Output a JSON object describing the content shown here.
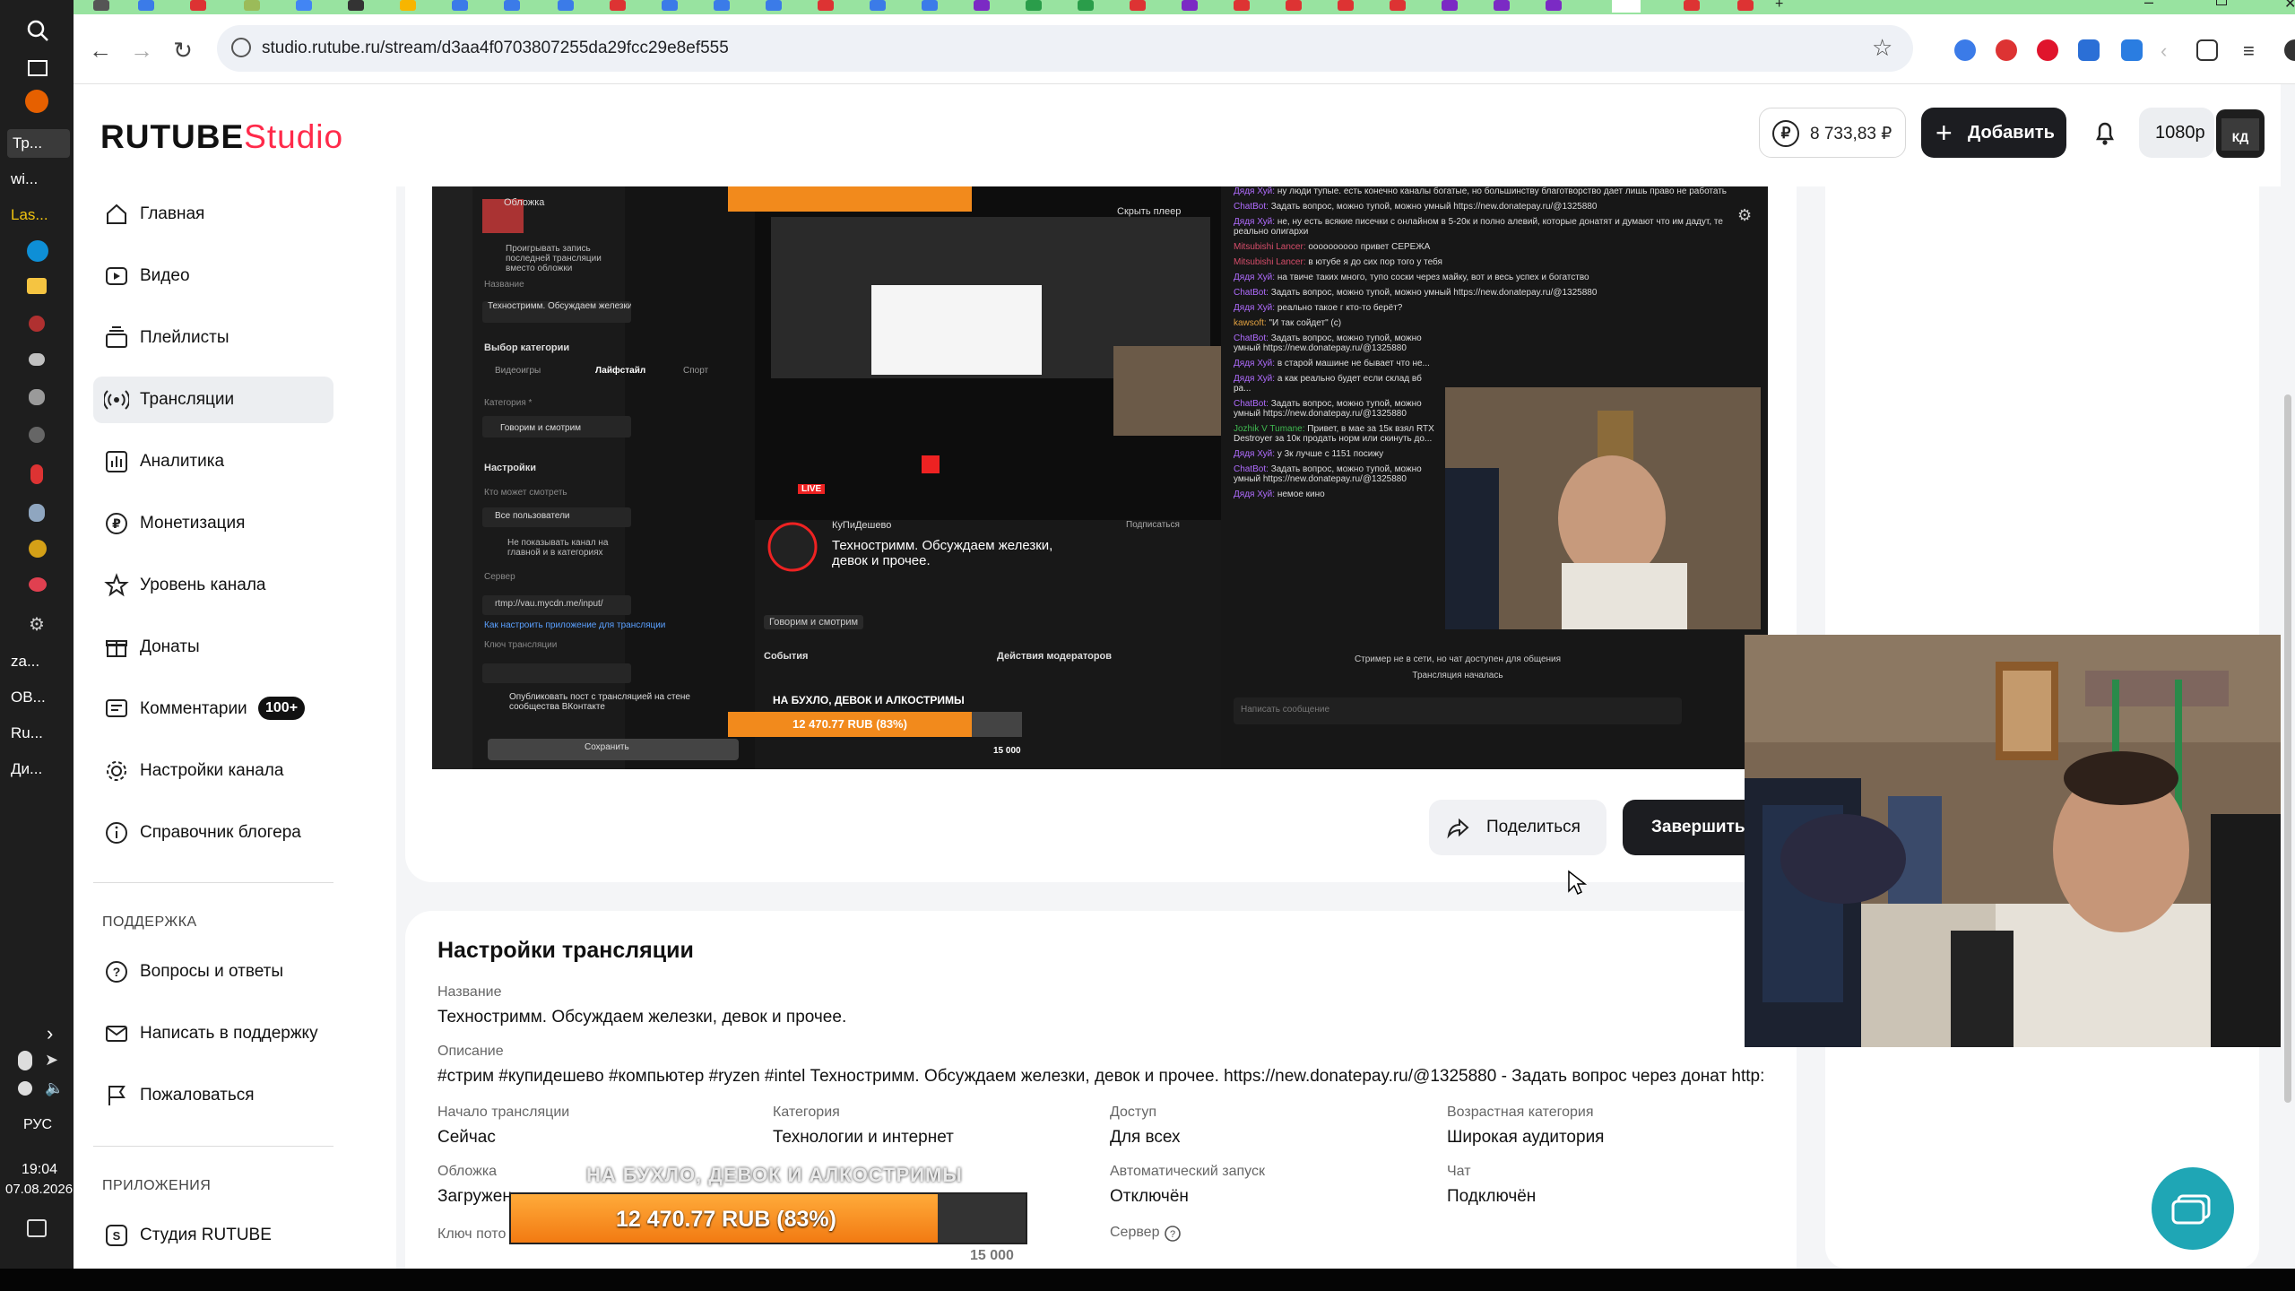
{
  "browser": {
    "url": "studio.rutube.ru/stream/d3aa4f0703807255da29fcc29e8ef555"
  },
  "taskbar": {
    "items": [
      "Тр...",
      "wi...",
      "Las...",
      "za...",
      "ОВ...",
      "Ru...",
      "Ди..."
    ],
    "lang": "РУС",
    "time": "19:04",
    "date": "07.08.2026"
  },
  "header": {
    "logo_main": "RUTUBE",
    "logo_studio": "Studio",
    "balance": "8 733,83 ₽",
    "add_label": "Добавить",
    "quality": "1080p"
  },
  "sidebar": {
    "items": [
      {
        "label": "Главная",
        "icon": "home-icon"
      },
      {
        "label": "Видео",
        "icon": "video-icon"
      },
      {
        "label": "Плейлисты",
        "icon": "playlist-icon"
      },
      {
        "label": "Трансляции",
        "icon": "broadcast-icon"
      },
      {
        "label": "Аналитика",
        "icon": "analytics-icon"
      },
      {
        "label": "Монетизация",
        "icon": "ruble-icon"
      },
      {
        "label": "Уровень канала",
        "icon": "star-icon"
      },
      {
        "label": "Донаты",
        "icon": "gift-icon"
      },
      {
        "label": "Комментарии",
        "icon": "comment-icon",
        "badge": "100+"
      },
      {
        "label": "Настройки канала",
        "icon": "gear-icon"
      },
      {
        "label": "Справочник блогера",
        "icon": "info-icon"
      }
    ],
    "support_title": "ПОДДЕРЖКА",
    "support_items": [
      {
        "label": "Вопросы и ответы",
        "icon": "question-icon"
      },
      {
        "label": "Написать в поддержку",
        "icon": "mail-icon"
      },
      {
        "label": "Пожаловаться",
        "icon": "flag-icon"
      }
    ],
    "apps_title": "ПРИЛОЖЕНИЯ",
    "apps_items": [
      {
        "label": "Студия RUTUBE",
        "icon": "studio-app-icon"
      }
    ]
  },
  "player": {
    "live_badge": "LIVE",
    "hide_player": "Скрыть плеер",
    "channel": "КуПиДешево",
    "stream_title": "Техностримм. Обсуждаем железки, девок и прочее.",
    "category_chip": "Говорим и смотрим",
    "events": "События",
    "mod_actions": "Действия модераторов",
    "subscribe": "Подписаться",
    "donation_label": "НА БУХЛО, ДЕВОК И АЛКОСТРИМЫ",
    "donation_amount": "12 470.77 RUB (83%)",
    "donation_goal": "15 000",
    "chat_input": "Написать сообщение",
    "chat_messages": [
      {
        "user": "Дядя Хуй:",
        "text": "ну люди тупые. есть конечно каналы богатые, но большинству благотворство дает лишь право не работать"
      },
      {
        "user": "ChatBot:",
        "text": "Задать вопрос, можно тупой, можно умный https://new.donatepay.ru/@1325880"
      },
      {
        "user": "Дядя Хуй:",
        "text": "не, ну есть всякие писечки с онлайном в 5-20к и полно алевий, которые донатят и думают что им дадут, те реально олигархи"
      },
      {
        "user": "Mitsubishi Lancer:",
        "text": "оооооооооо привет СЕРЕЖА"
      },
      {
        "user": "Mitsubishi Lancer:",
        "text": "в ютубе я до сих пор того у тебя"
      },
      {
        "user": "Дядя Хуй:",
        "text": "на твиче таких много, тупо соски через майку, вот и весь успех и богатство"
      },
      {
        "user": "ChatBot:",
        "text": "Задать вопрос, можно тупой, можно умный https://new.donatepay.ru/@1325880"
      },
      {
        "user": "Дядя Хуй:",
        "text": "реально такое г кто-то берёт?"
      },
      {
        "user": "kawsoft:",
        "text": "\"И так сойдет\" (с)"
      },
      {
        "user": "ChatBot:",
        "text": "Задать вопрос, можно тупой, можно умный https://new.donatepay.ru/@1325880"
      },
      {
        "user": "Дядя Хуй:",
        "text": "в старой машине не бывает что не..."
      },
      {
        "user": "Дядя Хуй:",
        "text": "а как реально будет если склад вб ра..."
      },
      {
        "user": "ChatBot:",
        "text": "Задать вопрос, можно тупой, можно умный https://new.donatepay.ru/@1325880"
      },
      {
        "user": "Jozhik V Tumane:",
        "text": "Привет, в мае за 15к взял RTX Destroyer за 10к продать норм или скинуть до..."
      },
      {
        "user": "Дядя Хуй:",
        "text": "у 3к лучше с 1151 посижу"
      },
      {
        "user": "ChatBot:",
        "text": "Задать вопрос, можно тупой, можно умный https://new.donatepay.ru/@1325880"
      },
      {
        "user": "Дядя Хуй:",
        "text": "немое кино"
      }
    ],
    "chat_system_1": "Стример не в сети, но чат доступен для общения",
    "chat_system_2": "Трансляция началась",
    "inner_form": {
      "cover": "Обложка",
      "checkbox_last": "Проигрывать запись последней трансляции вместо обложки",
      "name_label": "Название",
      "name_value": "Техностримм. Обсуждаем железки, девок и прочее.",
      "cat_title": "Выбор категории",
      "cat_opts": [
        "Видеоигры",
        "Лайфстайл",
        "Спорт"
      ],
      "cat_label": "Категория *",
      "cat_value": "Говорим и смотрим",
      "settings": "Настройки",
      "who_label": "Кто может смотреть",
      "who_value": "Все пользователи",
      "hide_cb": "Не показывать канал на главной и в категориях",
      "server_label": "Сервер",
      "server_value": "rtmp://vau.mycdn.me/input/",
      "setup_link": "Как настроить приложение для трансляции",
      "key_label": "Ключ трансляции",
      "publish_cb": "Опубликовать пост с трансляцией на стене сообщества ВКонтакте",
      "save": "Сохранить"
    }
  },
  "actions": {
    "share": "Поделиться",
    "end": "Завершить"
  },
  "settings": {
    "title": "Настройки трансляции",
    "name_label": "Название",
    "name_value": "Техностримм. Обсуждаем железки, девок и прочее.",
    "desc_label": "Описание",
    "desc_value": "#стрим #купидешево #компьютер #ryzen #intel Техностримм. Обсуждаем железки, девок и прочее. https://new.donatepay.ru/@1325880 - Задать вопрос через донат http:...",
    "start_label": "Начало трансляции",
    "start_value": "Сейчас",
    "cat_label": "Категория",
    "cat_value": "Технологии и интернет",
    "access_label": "Доступ",
    "access_value": "Для всех",
    "age_label": "Возрастная категория",
    "age_value": "Широкая аудитория",
    "cover_label": "Обложка",
    "cover_value": "Загружен",
    "auto_label": "Автоматический запуск",
    "auto_value": "Отключён",
    "chat_label": "Чат",
    "chat_value": "Подключён",
    "key_label": "Ключ пото",
    "server_label": "Сервер"
  },
  "donation_overlay": {
    "label": "НА БУХЛО, ДЕВОК И АЛКОСТРИМЫ",
    "amount": "12 470.77 RUB (83%)",
    "progress": 0.83,
    "goal": "15 000"
  },
  "colors": {
    "accent": "#ff2a4a",
    "dark_button": "#1c1d21",
    "donation": "#f28a1c",
    "help_button": "#1fa6b5"
  }
}
